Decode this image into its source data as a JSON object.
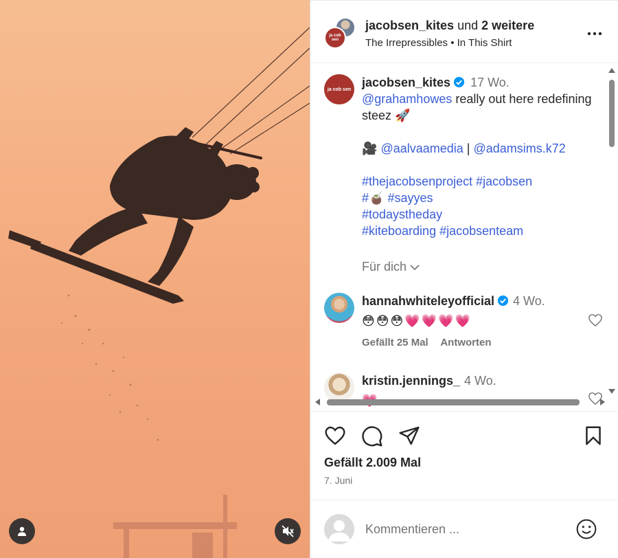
{
  "header": {
    "username": "jacobsen_kites",
    "and_more": "und",
    "others": "2 weitere",
    "audio": "The Irrepressibles • In This Shirt",
    "avatar_text": "ja cob sen"
  },
  "caption": {
    "username": "jacobsen_kites",
    "time": "17 Wo.",
    "mention": "@grahamhowes",
    "text1": "really out here redefining steez 🚀",
    "camera": "🎥",
    "mention2": "@aalvaamedia",
    "sep": "|",
    "mention3": "@adamsims.k72",
    "tags1": "#thejacobsenproject #jacobsen",
    "tags2_hash": "#",
    "tags2_emoji": "🧉",
    "tags2": "#sayyes",
    "tags3": "#todaystheday",
    "tags4": "#kiteboarding #jacobsenteam",
    "for_you": "Für dich"
  },
  "comments": [
    {
      "username": "hannahwhiteleyofficial",
      "time": "4 Wo.",
      "text": "😳😳😳💗💗💗💗",
      "likes": "Gefällt 25 Mal",
      "reply": "Antworten"
    },
    {
      "username": "kristin.jennings_",
      "time": "4 Wo.",
      "text": "💗"
    }
  ],
  "actions": {
    "likes": "Gefällt 2.009 Mal",
    "date": "7. Juni"
  },
  "composer": {
    "placeholder": "Kommentieren ..."
  },
  "colors": {
    "link": "#3b5ed6",
    "brand": "#a8342d",
    "verified": "#0095f6",
    "sky_top": "#f6bd92",
    "sky_bottom": "#ef9f74"
  },
  "icons": [
    "tag-user-icon",
    "mute-icon",
    "more-icon",
    "verified-icon",
    "chevron-down-icon",
    "heart-icon",
    "comment-icon",
    "share-icon",
    "bookmark-icon",
    "emoji-icon"
  ]
}
